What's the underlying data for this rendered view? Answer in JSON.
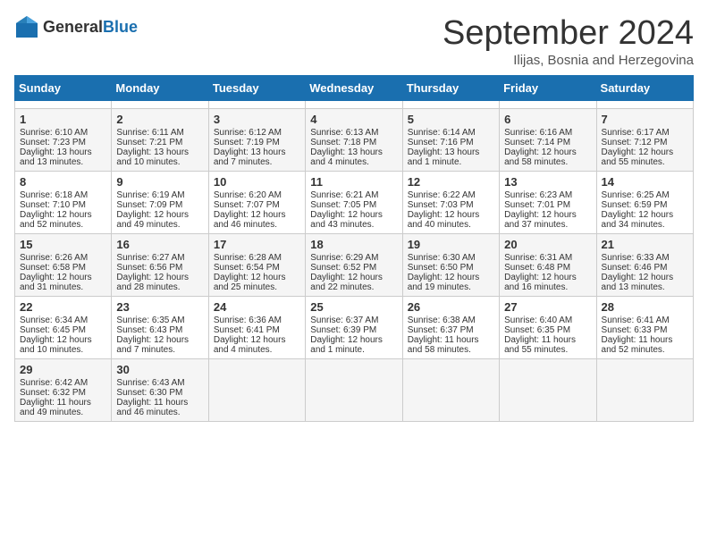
{
  "header": {
    "logo_general": "General",
    "logo_blue": "Blue",
    "month_title": "September 2024",
    "subtitle": "Ilijas, Bosnia and Herzegovina"
  },
  "calendar": {
    "days_of_week": [
      "Sunday",
      "Monday",
      "Tuesday",
      "Wednesday",
      "Thursday",
      "Friday",
      "Saturday"
    ],
    "weeks": [
      [
        {
          "day": "",
          "empty": true
        },
        {
          "day": "",
          "empty": true
        },
        {
          "day": "",
          "empty": true
        },
        {
          "day": "",
          "empty": true
        },
        {
          "day": "",
          "empty": true
        },
        {
          "day": "",
          "empty": true
        },
        {
          "day": "",
          "empty": true
        }
      ],
      [
        {
          "day": "1",
          "sunrise": "Sunrise: 6:10 AM",
          "sunset": "Sunset: 7:23 PM",
          "daylight": "Daylight: 13 hours and 13 minutes."
        },
        {
          "day": "2",
          "sunrise": "Sunrise: 6:11 AM",
          "sunset": "Sunset: 7:21 PM",
          "daylight": "Daylight: 13 hours and 10 minutes."
        },
        {
          "day": "3",
          "sunrise": "Sunrise: 6:12 AM",
          "sunset": "Sunset: 7:19 PM",
          "daylight": "Daylight: 13 hours and 7 minutes."
        },
        {
          "day": "4",
          "sunrise": "Sunrise: 6:13 AM",
          "sunset": "Sunset: 7:18 PM",
          "daylight": "Daylight: 13 hours and 4 minutes."
        },
        {
          "day": "5",
          "sunrise": "Sunrise: 6:14 AM",
          "sunset": "Sunset: 7:16 PM",
          "daylight": "Daylight: 13 hours and 1 minute."
        },
        {
          "day": "6",
          "sunrise": "Sunrise: 6:16 AM",
          "sunset": "Sunset: 7:14 PM",
          "daylight": "Daylight: 12 hours and 58 minutes."
        },
        {
          "day": "7",
          "sunrise": "Sunrise: 6:17 AM",
          "sunset": "Sunset: 7:12 PM",
          "daylight": "Daylight: 12 hours and 55 minutes."
        }
      ],
      [
        {
          "day": "8",
          "sunrise": "Sunrise: 6:18 AM",
          "sunset": "Sunset: 7:10 PM",
          "daylight": "Daylight: 12 hours and 52 minutes."
        },
        {
          "day": "9",
          "sunrise": "Sunrise: 6:19 AM",
          "sunset": "Sunset: 7:09 PM",
          "daylight": "Daylight: 12 hours and 49 minutes."
        },
        {
          "day": "10",
          "sunrise": "Sunrise: 6:20 AM",
          "sunset": "Sunset: 7:07 PM",
          "daylight": "Daylight: 12 hours and 46 minutes."
        },
        {
          "day": "11",
          "sunrise": "Sunrise: 6:21 AM",
          "sunset": "Sunset: 7:05 PM",
          "daylight": "Daylight: 12 hours and 43 minutes."
        },
        {
          "day": "12",
          "sunrise": "Sunrise: 6:22 AM",
          "sunset": "Sunset: 7:03 PM",
          "daylight": "Daylight: 12 hours and 40 minutes."
        },
        {
          "day": "13",
          "sunrise": "Sunrise: 6:23 AM",
          "sunset": "Sunset: 7:01 PM",
          "daylight": "Daylight: 12 hours and 37 minutes."
        },
        {
          "day": "14",
          "sunrise": "Sunrise: 6:25 AM",
          "sunset": "Sunset: 6:59 PM",
          "daylight": "Daylight: 12 hours and 34 minutes."
        }
      ],
      [
        {
          "day": "15",
          "sunrise": "Sunrise: 6:26 AM",
          "sunset": "Sunset: 6:58 PM",
          "daylight": "Daylight: 12 hours and 31 minutes."
        },
        {
          "day": "16",
          "sunrise": "Sunrise: 6:27 AM",
          "sunset": "Sunset: 6:56 PM",
          "daylight": "Daylight: 12 hours and 28 minutes."
        },
        {
          "day": "17",
          "sunrise": "Sunrise: 6:28 AM",
          "sunset": "Sunset: 6:54 PM",
          "daylight": "Daylight: 12 hours and 25 minutes."
        },
        {
          "day": "18",
          "sunrise": "Sunrise: 6:29 AM",
          "sunset": "Sunset: 6:52 PM",
          "daylight": "Daylight: 12 hours and 22 minutes."
        },
        {
          "day": "19",
          "sunrise": "Sunrise: 6:30 AM",
          "sunset": "Sunset: 6:50 PM",
          "daylight": "Daylight: 12 hours and 19 minutes."
        },
        {
          "day": "20",
          "sunrise": "Sunrise: 6:31 AM",
          "sunset": "Sunset: 6:48 PM",
          "daylight": "Daylight: 12 hours and 16 minutes."
        },
        {
          "day": "21",
          "sunrise": "Sunrise: 6:33 AM",
          "sunset": "Sunset: 6:46 PM",
          "daylight": "Daylight: 12 hours and 13 minutes."
        }
      ],
      [
        {
          "day": "22",
          "sunrise": "Sunrise: 6:34 AM",
          "sunset": "Sunset: 6:45 PM",
          "daylight": "Daylight: 12 hours and 10 minutes."
        },
        {
          "day": "23",
          "sunrise": "Sunrise: 6:35 AM",
          "sunset": "Sunset: 6:43 PM",
          "daylight": "Daylight: 12 hours and 7 minutes."
        },
        {
          "day": "24",
          "sunrise": "Sunrise: 6:36 AM",
          "sunset": "Sunset: 6:41 PM",
          "daylight": "Daylight: 12 hours and 4 minutes."
        },
        {
          "day": "25",
          "sunrise": "Sunrise: 6:37 AM",
          "sunset": "Sunset: 6:39 PM",
          "daylight": "Daylight: 12 hours and 1 minute."
        },
        {
          "day": "26",
          "sunrise": "Sunrise: 6:38 AM",
          "sunset": "Sunset: 6:37 PM",
          "daylight": "Daylight: 11 hours and 58 minutes."
        },
        {
          "day": "27",
          "sunrise": "Sunrise: 6:40 AM",
          "sunset": "Sunset: 6:35 PM",
          "daylight": "Daylight: 11 hours and 55 minutes."
        },
        {
          "day": "28",
          "sunrise": "Sunrise: 6:41 AM",
          "sunset": "Sunset: 6:33 PM",
          "daylight": "Daylight: 11 hours and 52 minutes."
        }
      ],
      [
        {
          "day": "29",
          "sunrise": "Sunrise: 6:42 AM",
          "sunset": "Sunset: 6:32 PM",
          "daylight": "Daylight: 11 hours and 49 minutes."
        },
        {
          "day": "30",
          "sunrise": "Sunrise: 6:43 AM",
          "sunset": "Sunset: 6:30 PM",
          "daylight": "Daylight: 11 hours and 46 minutes."
        },
        {
          "day": "",
          "empty": true
        },
        {
          "day": "",
          "empty": true
        },
        {
          "day": "",
          "empty": true
        },
        {
          "day": "",
          "empty": true
        },
        {
          "day": "",
          "empty": true
        }
      ]
    ]
  }
}
